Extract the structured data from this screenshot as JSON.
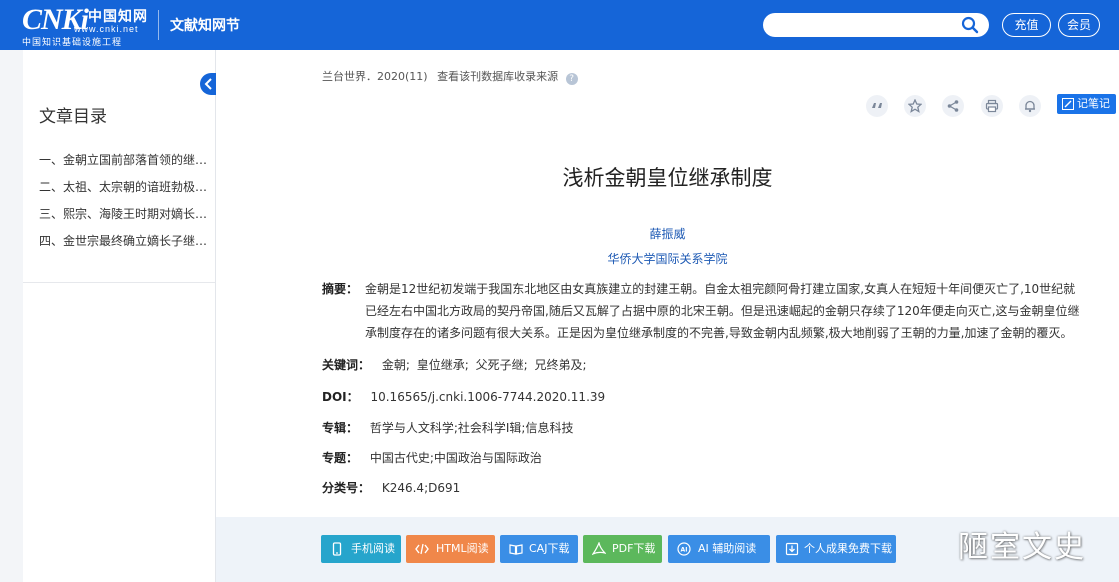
{
  "header": {
    "logo_mark": "CNKi",
    "logo_cn": "中国知网",
    "logo_url": "www.cnki.net",
    "logo_sub": "中国知识基础设施工程",
    "site_name": "文献知网节",
    "search_placeholder": "",
    "recharge": "充值",
    "member": "会员"
  },
  "sidebar": {
    "title": "文章目录",
    "items": [
      "一、金朝立国前部落首领的继承制度",
      "二、太祖、太宗朝的谙班勃极烈制度",
      "三、熙宗、海陵王时期对嫡长子继承制的确立",
      "四、金世宗最终确立嫡长子继承制"
    ]
  },
  "article": {
    "source": "兰台世界．2020(11)",
    "source_link": "查看该刊数据库收录来源",
    "note_label": "记笔记",
    "title": "浅析金朝皇位继承制度",
    "author": "薛振威",
    "affiliation": "华侨大学国际关系学院",
    "abstract_label": "摘要：",
    "abstract_lines": [
      "金朝是12世纪初发端于我国东北地区由女真族建立的封建王朝。自金太祖完颜阿骨打建立国家,女真人在短短十年间便灭亡了,10世纪就",
      "已经左右中国北方政局的契丹帝国,随后又瓦解了占据中原的北宋王朝。但是迅速崛起的金朝只存续了120年便走向灭亡,这与金朝皇位继",
      "承制度存在的诸多问题有很大关系。正是因为皇位继承制度的不完善,导致金朝内乱频繁,极大地削弱了王朝的力量,加速了金朝的覆灭。"
    ],
    "keywords_label": "关键词：",
    "keywords": [
      "金朝;",
      "皇位继承;",
      "父死子继;",
      "兄终弟及;"
    ],
    "doi_label": "DOI：",
    "doi": "10.16565/j.cnki.1006-7744.2020.11.39",
    "series_label": "专辑：",
    "series": "哲学与人文科学;社会科学Ⅰ辑;信息科技",
    "topic_label": "专题：",
    "topic": "中国古代史;中国政治与国际政治",
    "class_label": "分类号：",
    "class": "K246.4;D691"
  },
  "actions": {
    "mobile": "手机阅读",
    "html": "HTML阅读",
    "caj": "CAJ下载",
    "pdf": "PDF下载",
    "ai": "AI 辅助阅读",
    "personal": "个人成果免费下载"
  },
  "watermark": "陋室文史",
  "colors": {
    "header_blue": "#1565d8",
    "link_blue": "#1e5ab4",
    "mobile_btn": "#26a5cc",
    "html_btn": "#f0874a",
    "blue_btn": "#3a8ee6",
    "pdf_btn": "#5cb85c"
  }
}
